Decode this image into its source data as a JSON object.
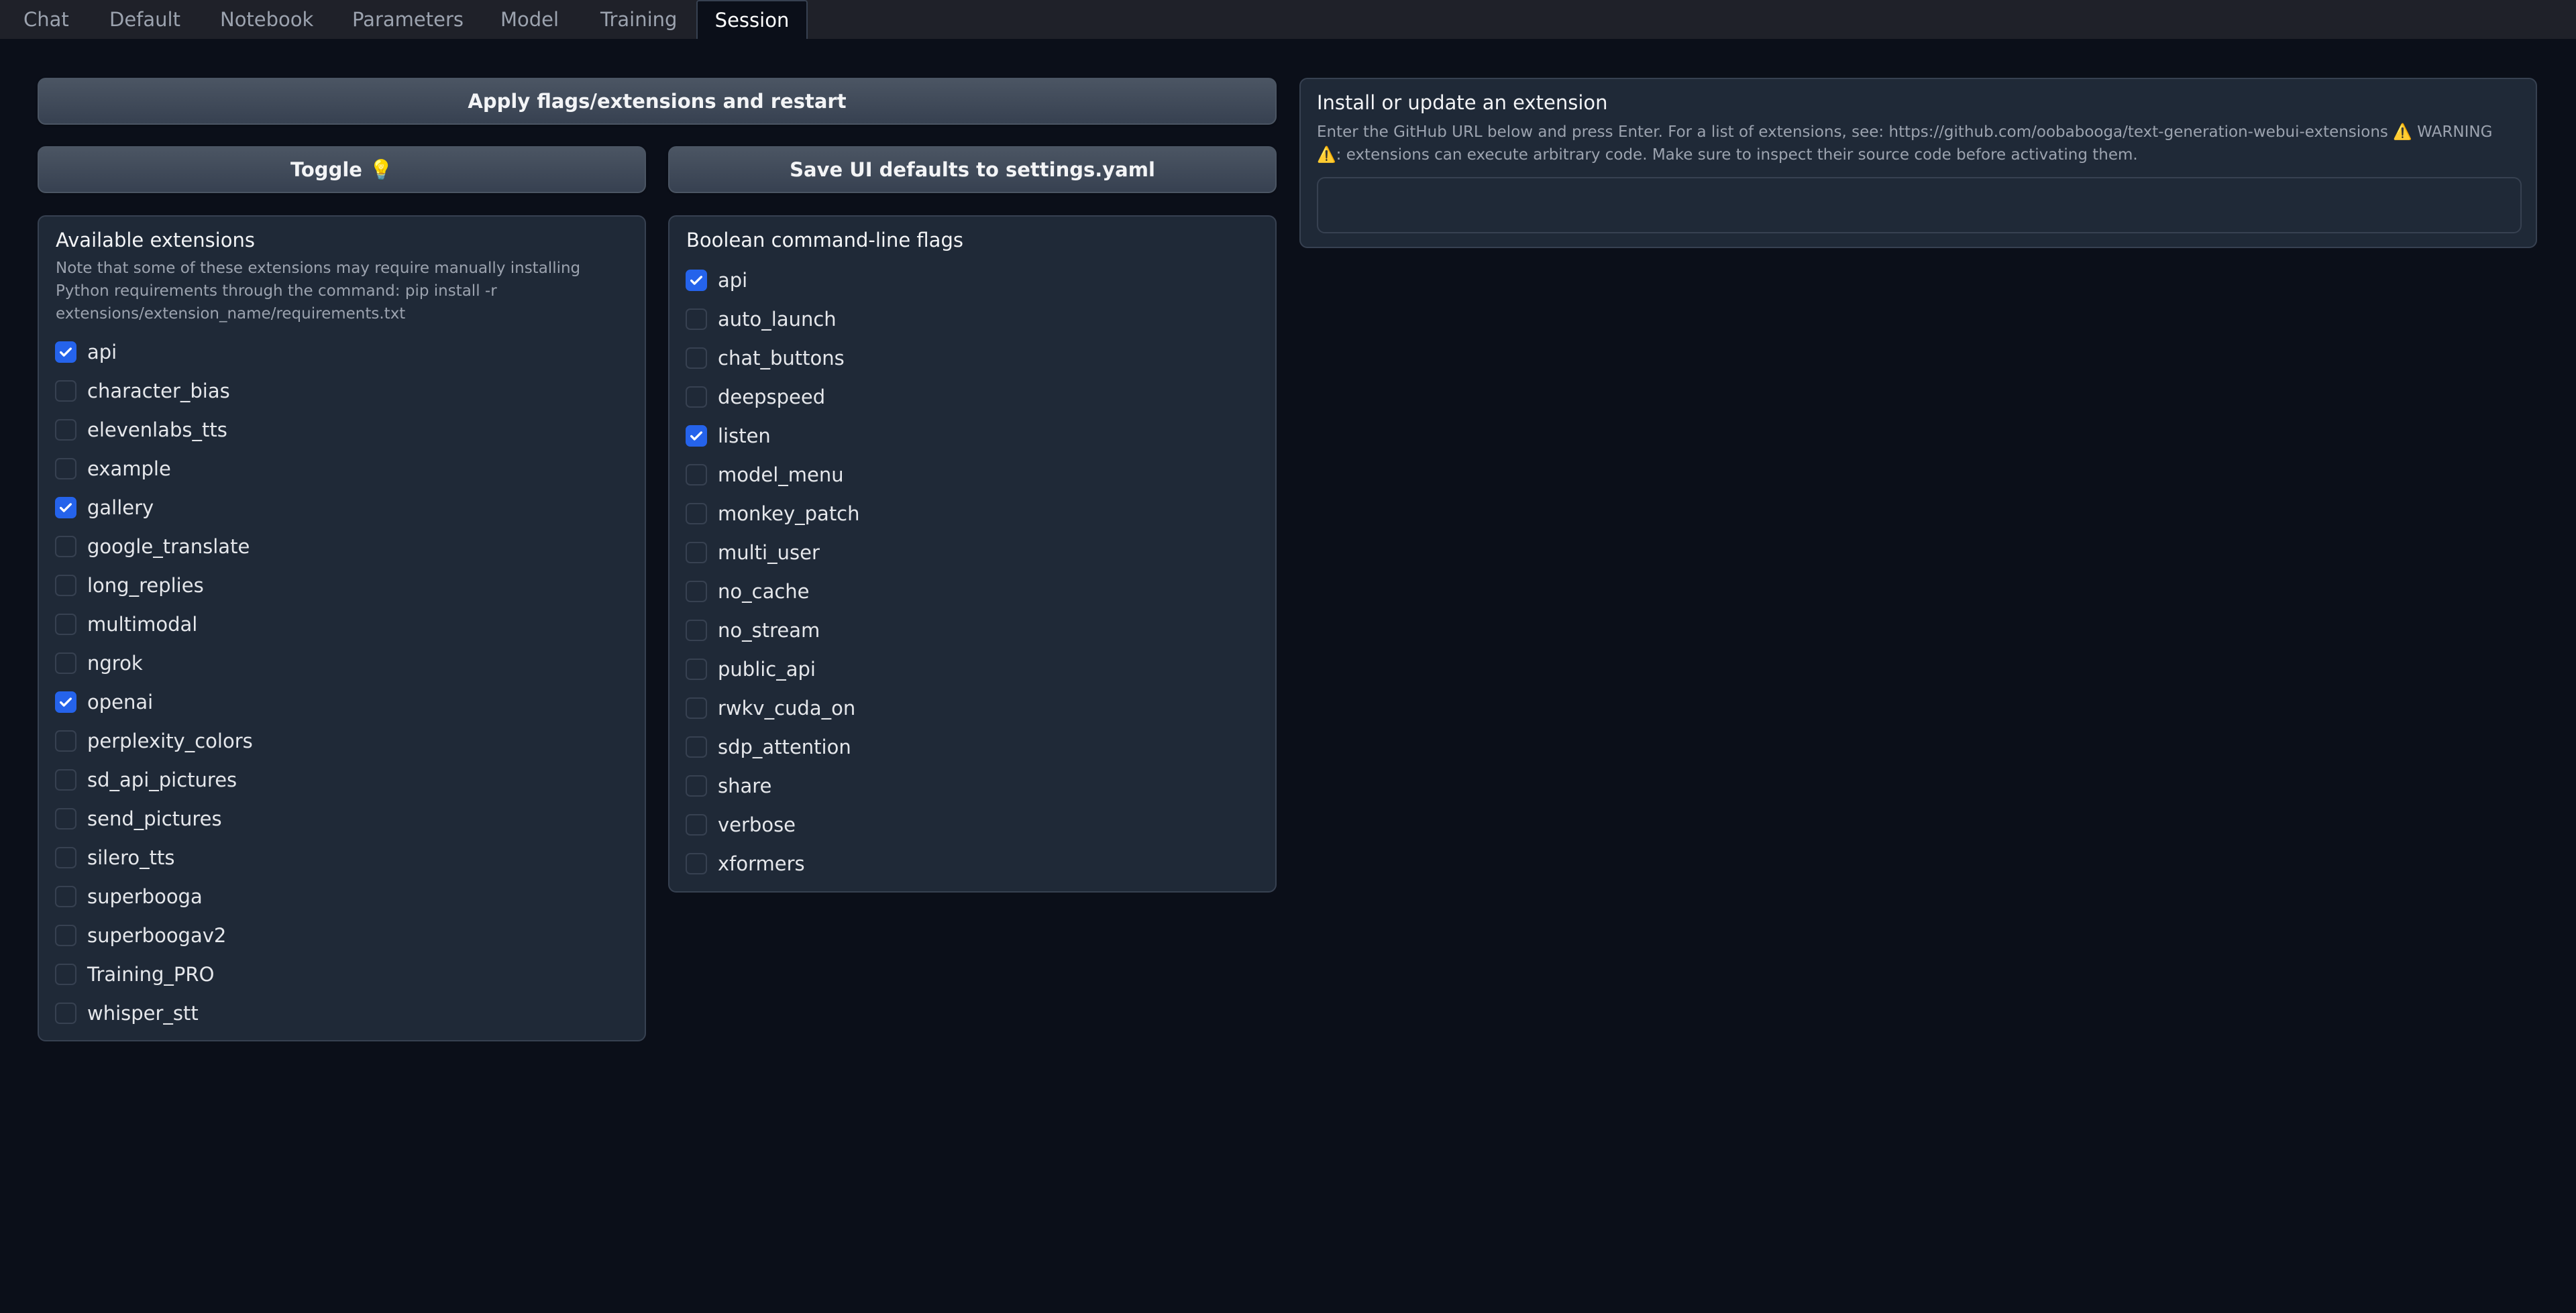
{
  "tabs": [
    {
      "label": "Chat",
      "selected": false
    },
    {
      "label": "Default",
      "selected": false
    },
    {
      "label": "Notebook",
      "selected": false
    },
    {
      "label": "Parameters",
      "selected": false
    },
    {
      "label": "Model",
      "selected": false
    },
    {
      "label": "Training",
      "selected": false
    },
    {
      "label": "Session",
      "selected": true
    }
  ],
  "buttons": {
    "apply": "Apply flags/extensions and restart",
    "toggle": "Toggle",
    "toggle_icon": "💡",
    "save_defaults": "Save UI defaults to settings.yaml"
  },
  "extensions_panel": {
    "title": "Available extensions",
    "description": "Note that some of these extensions may require manually installing Python requirements through the command: pip install -r extensions/extension_name/requirements.txt",
    "items": [
      {
        "label": "api",
        "checked": true
      },
      {
        "label": "character_bias",
        "checked": false
      },
      {
        "label": "elevenlabs_tts",
        "checked": false
      },
      {
        "label": "example",
        "checked": false
      },
      {
        "label": "gallery",
        "checked": true
      },
      {
        "label": "google_translate",
        "checked": false
      },
      {
        "label": "long_replies",
        "checked": false
      },
      {
        "label": "multimodal",
        "checked": false
      },
      {
        "label": "ngrok",
        "checked": false
      },
      {
        "label": "openai",
        "checked": true
      },
      {
        "label": "perplexity_colors",
        "checked": false
      },
      {
        "label": "sd_api_pictures",
        "checked": false
      },
      {
        "label": "send_pictures",
        "checked": false
      },
      {
        "label": "silero_tts",
        "checked": false
      },
      {
        "label": "superbooga",
        "checked": false
      },
      {
        "label": "superboogav2",
        "checked": false
      },
      {
        "label": "Training_PRO",
        "checked": false
      },
      {
        "label": "whisper_stt",
        "checked": false
      }
    ]
  },
  "flags_panel": {
    "title": "Boolean command-line flags",
    "items": [
      {
        "label": "api",
        "checked": true
      },
      {
        "label": "auto_launch",
        "checked": false
      },
      {
        "label": "chat_buttons",
        "checked": false
      },
      {
        "label": "deepspeed",
        "checked": false
      },
      {
        "label": "listen",
        "checked": true
      },
      {
        "label": "model_menu",
        "checked": false
      },
      {
        "label": "monkey_patch",
        "checked": false
      },
      {
        "label": "multi_user",
        "checked": false
      },
      {
        "label": "no_cache",
        "checked": false
      },
      {
        "label": "no_stream",
        "checked": false
      },
      {
        "label": "public_api",
        "checked": false
      },
      {
        "label": "rwkv_cuda_on",
        "checked": false
      },
      {
        "label": "sdp_attention",
        "checked": false
      },
      {
        "label": "share",
        "checked": false
      },
      {
        "label": "verbose",
        "checked": false
      },
      {
        "label": "xformers",
        "checked": false
      }
    ]
  },
  "install_panel": {
    "title": "Install or update an extension",
    "description_part1": "Enter the GitHub URL below and press Enter. For a list of extensions, see: https://github.com/oobabooga/text-generation-webui-extensions ",
    "warning_icon": "⚠️",
    "warning_text": " WARNING ",
    "description_part2": ": extensions can execute arbitrary code. Make sure to inspect their source code before activating them.",
    "input_value": "",
    "input_placeholder": ""
  },
  "colors": {
    "background": "#0b0f19",
    "panel": "#1f2937",
    "border": "#374151",
    "accent": "#2563eb",
    "tabbar": "#1f2129"
  }
}
